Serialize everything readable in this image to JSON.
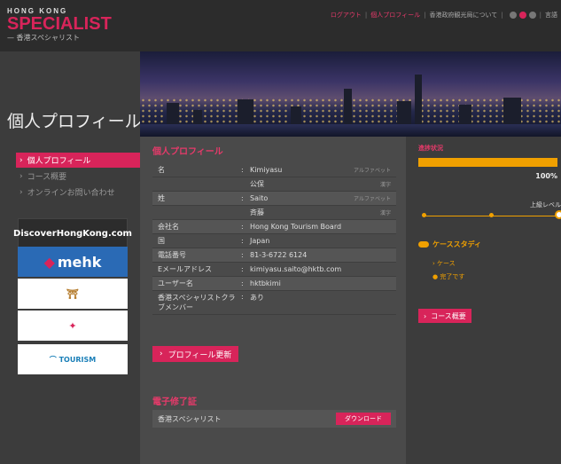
{
  "header": {
    "logo_line1": "HONG KONG",
    "logo_line2": "SPECIALIST",
    "logo_line3": "— 香港スペシャリスト",
    "nav": [
      "ログアウト",
      "個人プロフィール",
      "香港政府観光局について",
      "言語"
    ],
    "nav_colors": [
      "#e63a6a",
      "#e63a6a",
      "#aaaaaa",
      "#aaaaaa"
    ]
  },
  "sidebar": {
    "title": "個人プロフィール",
    "items": [
      {
        "label": "個人プロフィール",
        "active": true
      },
      {
        "label": "コース概要",
        "active": false
      },
      {
        "label": "オンラインお問い合わせ",
        "active": false
      }
    ],
    "banners": {
      "dhk": "DiscoverHongKong.com",
      "mehk": "mehk"
    }
  },
  "profile": {
    "title": "個人プロフィール",
    "rows": [
      {
        "label": "名",
        "value": "Kimiyasu",
        "hint": "アルファベット"
      },
      {
        "label": "",
        "value": "公保",
        "hint": "漢字"
      },
      {
        "label": "姓",
        "value": "Saito",
        "hint": "アルファベット"
      },
      {
        "label": "",
        "value": "斉藤",
        "hint": "漢字"
      },
      {
        "label": "会社名",
        "value": "Hong Kong Tourism Board",
        "hint": ""
      },
      {
        "label": "国",
        "value": "Japan",
        "hint": ""
      },
      {
        "label": "電話番号",
        "value": "81-3-6722 6124",
        "hint": ""
      },
      {
        "label": "Eメールアドレス",
        "value": "kimiyasu.saito@hktb.com",
        "hint": ""
      },
      {
        "label": "ユーザー名",
        "value": "hktbkimi",
        "hint": ""
      },
      {
        "label": "香港スペシャリストクラブメンバー",
        "value": "あり",
        "hint": ""
      }
    ],
    "update_button": "プロフィール更新"
  },
  "certificate": {
    "title": "電子修了証",
    "name": "香港スペシャリスト",
    "download_button": "ダウンロード"
  },
  "progress": {
    "title": "進捗状況",
    "fraction": 1.0,
    "percent_label": "100%",
    "level_label": "上級レベル",
    "case_title": "ケーススタディ",
    "case_items": [
      "ケース",
      "完了です"
    ],
    "course_button": "コース概要"
  },
  "colors": {
    "accent": "#d8245a",
    "progress": "#f0a000"
  }
}
